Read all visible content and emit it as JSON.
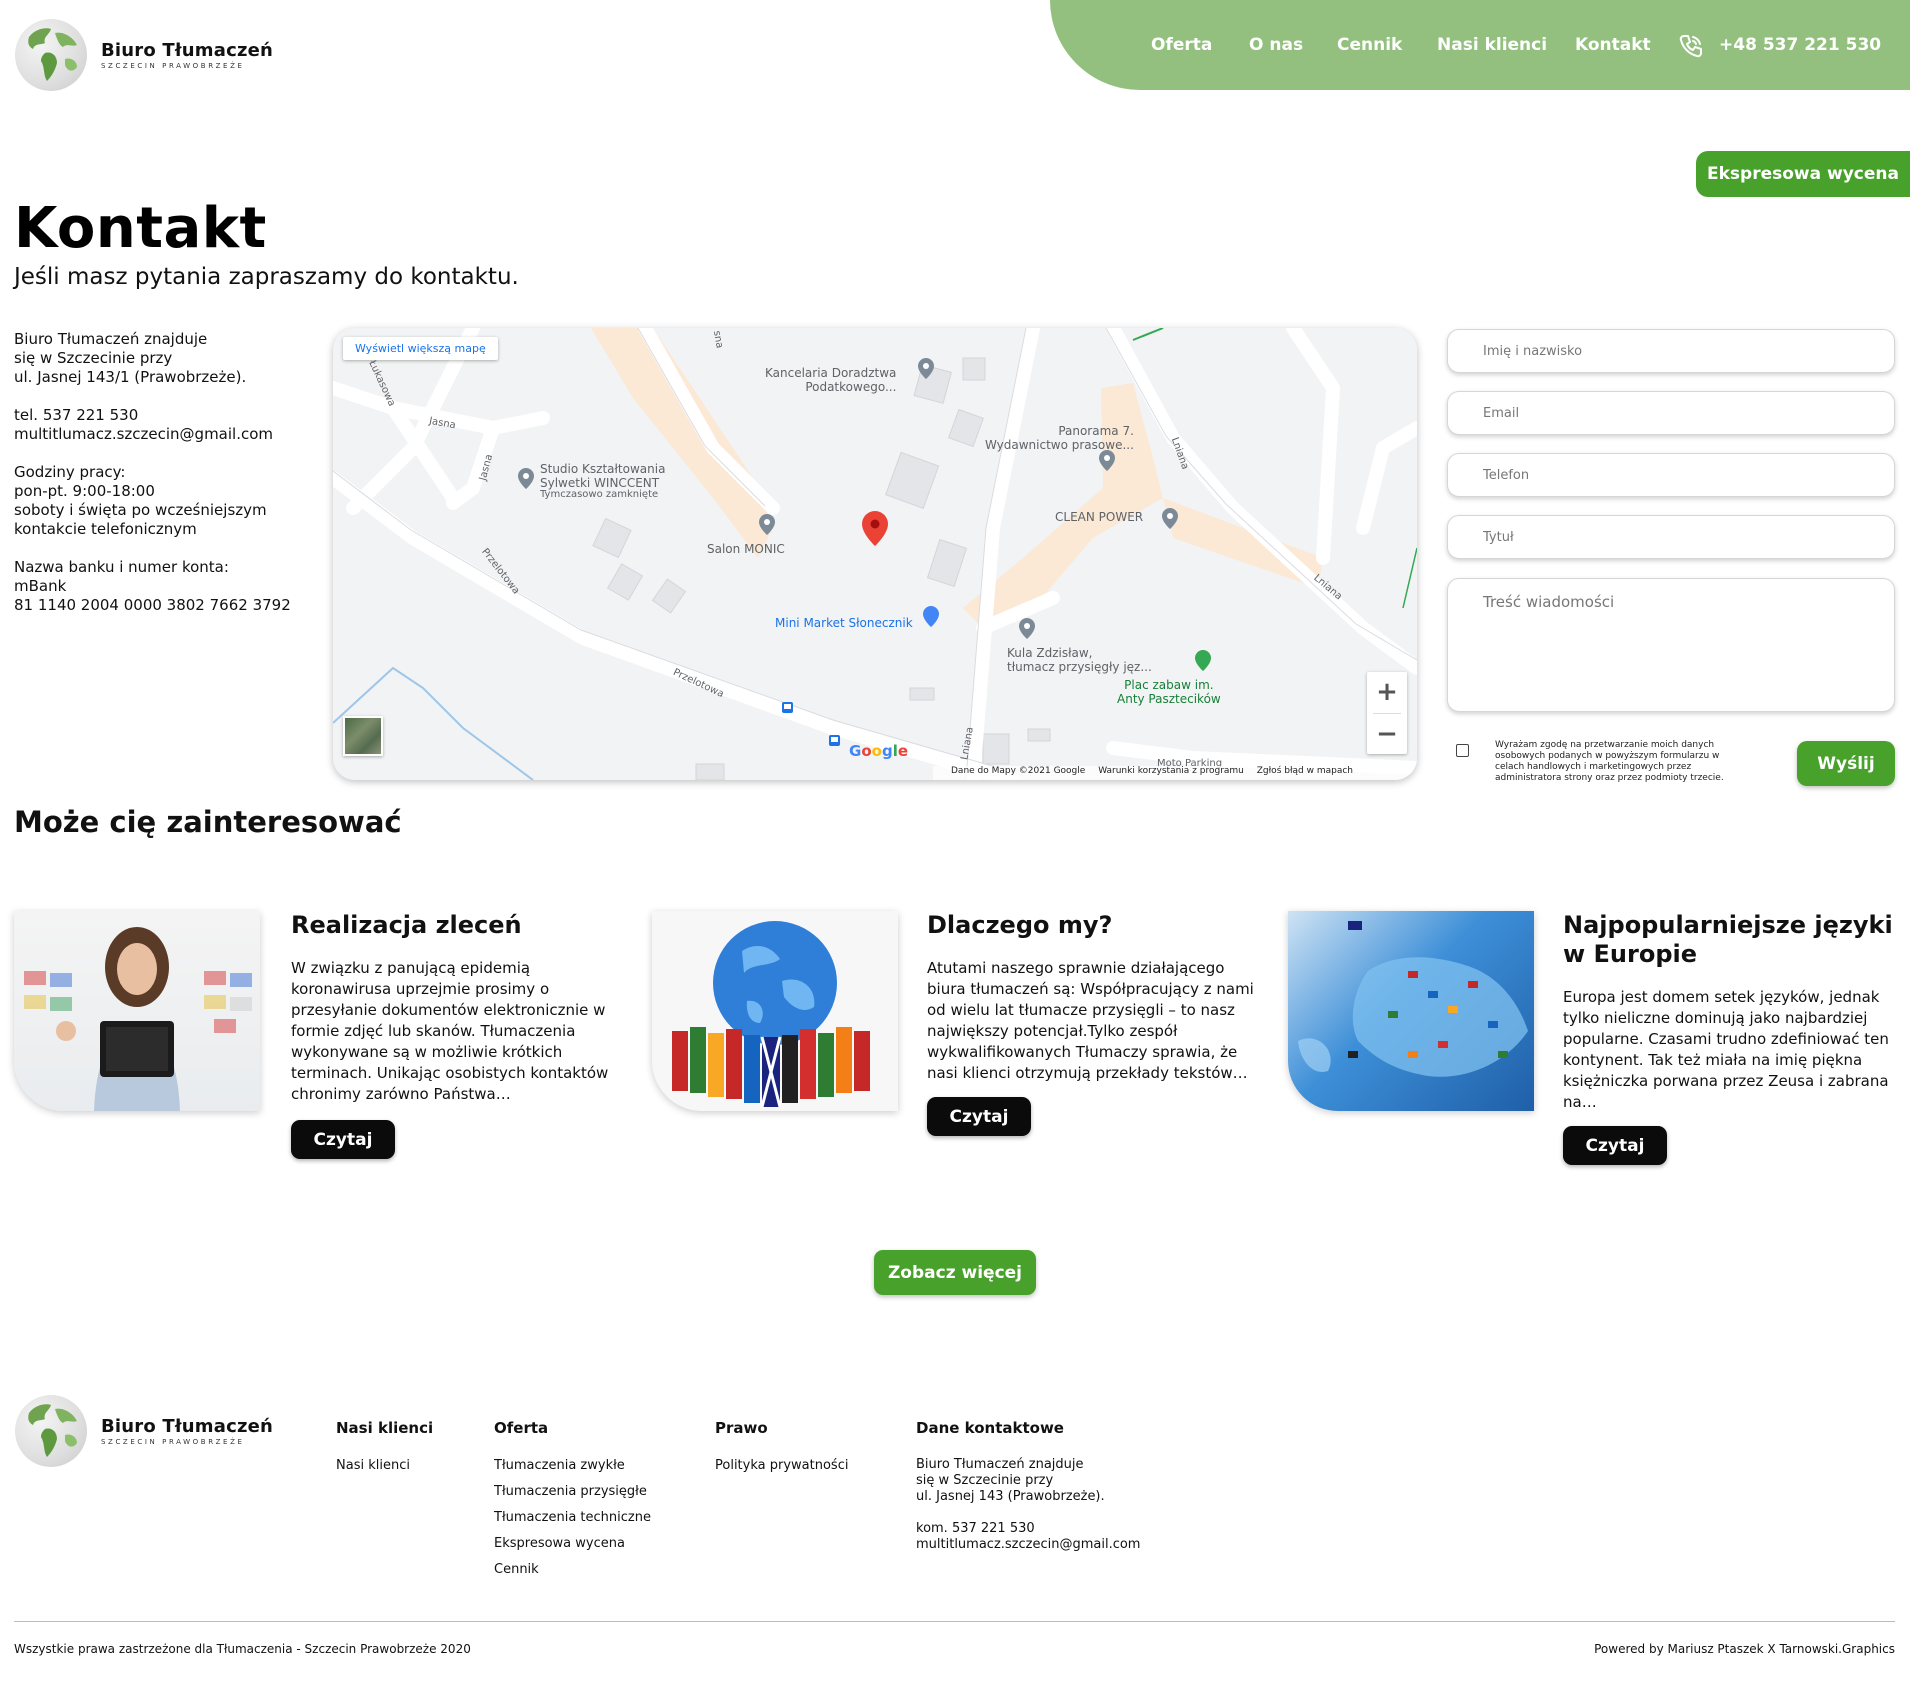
{
  "brand": {
    "title": "Biuro Tłumaczeń",
    "subtitle": "SZCZECIN PRAWOBRZEŻE",
    "logo_icon": "globe-icon"
  },
  "nav": {
    "items": [
      "Oferta",
      "O nas",
      "Cennik",
      "Nasi klienci",
      "Kontakt"
    ],
    "phone_icon": "phone-icon",
    "phone": "+48 537 221 530",
    "bar_color": "#93c07f"
  },
  "express_button": "Ekspresowa wycena",
  "page": {
    "title": "Kontakt",
    "subtitle": "Jeśli masz pytania zapraszamy do kontaktu."
  },
  "info": {
    "address": [
      "Biuro Tłumaczeń znajduje",
      "się w Szczecinie przy",
      "ul. Jasnej 143/1 (Prawobrzeże)."
    ],
    "contact": [
      "tel. 537 221 530",
      "multitlumacz.szczecin@gmail.com"
    ],
    "hours": [
      "Godziny pracy:",
      "pon-pt. 9:00-18:00",
      "soboty i święta po wcześniejszym",
      "kontakcie telefonicznym"
    ],
    "bank": [
      "Nazwa banku i numer konta:",
      "mBank",
      "81 1140 2004 0000 3802 7662 3792"
    ]
  },
  "map": {
    "larger_map": "Wyświetl większą mapę",
    "labels": {
      "kancelaria": "Kancelaria Doradztwa\nPodatkowego...",
      "panorama": "Panorama 7.\nWydawnictwo prasowe...",
      "studio": "Studio Kształtowania\nSylwetki WINCCENT",
      "studio_note": "Tymczasowo zamknięte",
      "salon": "Salon MONIC",
      "clean": "CLEAN POWER",
      "market": "Mini Market Słonecznik",
      "kula": "Kula Zdzisław,\ntłumacz przysięgły jęz...",
      "plac": "Plac zabaw im.\nAnty Pasztecików",
      "street_jasna1": "Jasna",
      "street_jasna2": "Jasna",
      "street_przelotowa1": "Przelotowa",
      "street_przelotowa2": "Przelotowa",
      "street_lniana1": "Lniana",
      "street_lniana2": "Lniana",
      "street_lniana3": "Lniana",
      "street_lukasowa": "Łukasowa",
      "street_sna": "sna",
      "moto": "Moto Parking"
    },
    "google": "Google",
    "footer": [
      "Dane do Mapy ©2021 Google",
      "Warunki korzystania z programu",
      "Zgłoś błąd w mapach"
    ],
    "zoom_in": "+",
    "zoom_out": "−"
  },
  "form": {
    "name_placeholder": "Imię i nazwisko",
    "email_placeholder": "Email",
    "phone_placeholder": "Telefon",
    "title_placeholder": "Tytuł",
    "message_placeholder": "Treść wiadomości",
    "consent": "Wyrażam zgodę na przetwarzanie moich danych osobowych podanych w powyższym formularzu w celach handlowych i marketingowych przez administratora strony oraz przez podmioty trzecie.",
    "send": "Wyślij"
  },
  "articles": {
    "section_title": "Może cię zainteresować",
    "items": [
      {
        "title": "Realizacja zleceń",
        "text": "W związku z panującą epidemią koronawirusa uprzejmie prosimy  o przesyłanie dokumentów elektronicznie w formie zdjęć lub skanów. Tłumaczenia wykonywane są w możliwie krótkich terminach. Unikając osobistych kontaktów chronimy zarówno Państwa…",
        "button": "Czytaj"
      },
      {
        "title": "Dlaczego my?",
        "text": "Atutami naszego sprawnie działającego biura tłumaczeń są: Współpracujący z nami od wielu lat tłumacze przysięgli – to nasz największy potencjał.Tylko zespół wykwalifikowanych Tłumaczy sprawia, że nasi klienci otrzymują przekłady tekstów…",
        "button": "Czytaj"
      },
      {
        "title": "Najpopularniejsze języki w Europie",
        "text": "Europa jest domem setek języków, jednak tylko nieliczne dominują jako najbardziej popularne. Czasami trudno zdefiniować  ten kontynent. Tak też miała na imię piękna księżniczka porwana przez Zeusa  i zabrana na…",
        "button": "Czytaj"
      }
    ],
    "more": "Zobacz więcej"
  },
  "footer": {
    "clients_title": "Nasi klienci",
    "clients_links": [
      "Nasi klienci"
    ],
    "offer_title": "Oferta",
    "offer_links": [
      "Tłumaczenia zwykłe",
      "Tłumaczenia przysięgłe",
      "Tłumaczenia techniczne",
      "Ekspresowa wycena",
      "Cennik"
    ],
    "law_title": "Prawo",
    "law_links": [
      "Polityka prywatności"
    ],
    "contact_title": "Dane kontaktowe",
    "contact_address": [
      "Biuro Tłumaczeń znajduje",
      "się w Szczecinie przy",
      "ul. Jasnej 143 (Prawobrzeże)."
    ],
    "contact_lines": [
      "kom. 537 221 530",
      "multitlumacz.szczecin@gmail.com"
    ],
    "copyright": "Wszystkie prawa zastrzeżone dla Tłumaczenia - Szczecin Prawobrzeże 2020",
    "powered": "Powered by Mariusz Ptaszek X Tarnowski.Graphics"
  },
  "colors": {
    "accent_green": "#47a12a",
    "nav_green": "#93c07f",
    "button_black": "#0b0b0b"
  }
}
